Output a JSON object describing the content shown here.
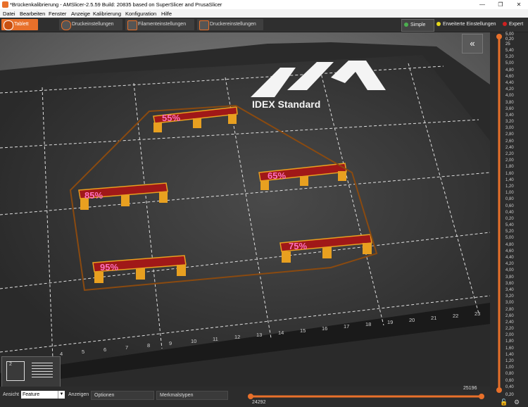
{
  "window": {
    "title": "*Brückenkalibrierung - AMSlicer-2.5.59 Build: 20835  based on SuperSlicer and PrusaSlicer",
    "minimize": "—",
    "restore": "❐",
    "close": "✕"
  },
  "menu": [
    "Datei",
    "Bearbeiten",
    "Fenster",
    "Anzeige",
    "Kalibrierung",
    "Konfiguration",
    "Hilfe"
  ],
  "tabs": [
    {
      "label": "Tablett",
      "active": true
    },
    {
      "label": "Druckeinstellungen"
    },
    {
      "label": "Filamenteinstellungen"
    },
    {
      "label": "Druckereinstellungen"
    }
  ],
  "modes": [
    {
      "label": "Simple",
      "color": "#4caf50"
    },
    {
      "label": "Erweiterte Einstellungen",
      "color": "#e6d81c"
    },
    {
      "label": "Expert",
      "color": "#d02020"
    }
  ],
  "bed": {
    "logo_text": "IDEX Standard",
    "x_ticks": [
      "4",
      "5",
      "6",
      "7",
      "8",
      "9",
      "10",
      "11",
      "12",
      "13",
      "14",
      "15",
      "16",
      "17",
      "18",
      "19",
      "20",
      "21",
      "22",
      "23"
    ]
  },
  "bridges": [
    {
      "label": "55%"
    },
    {
      "label": "65%"
    },
    {
      "label": "85%"
    },
    {
      "label": "75%"
    },
    {
      "label": "95%"
    }
  ],
  "collapse_icon": "«",
  "vslider": {
    "top_values": [
      "5,00",
      "0,20",
      "25"
    ],
    "labels": [
      "5,40",
      "5,20",
      "5,00",
      "4,80",
      "4,60",
      "4,40",
      "4,20",
      "4,00",
      "3,80",
      "3,60",
      "3,40",
      "3,20",
      "3,00",
      "2,80",
      "2,60",
      "2,40",
      "2,20",
      "2,00",
      "1,80",
      "1,60",
      "1,40",
      "1,20",
      "1,00",
      "0,80",
      "0,60",
      "0,40",
      "0,20",
      "5,40",
      "5,20",
      "5,00",
      "4,80",
      "4,60",
      "4,40",
      "4,20",
      "4,00",
      "3,80",
      "3,60",
      "3,40",
      "3,20",
      "3,00",
      "2,80",
      "2,60",
      "2,40",
      "2,20",
      "2,00",
      "1,80",
      "1,60",
      "1,40",
      "1,20",
      "1,00",
      "0,80",
      "0,60",
      "0,40"
    ],
    "bottom_values": [
      "0,20",
      "1"
    ]
  },
  "bottom": {
    "ansicht_label": "Ansicht",
    "view_value": "Feature",
    "anzeigen_label": "Anzeigen",
    "optionen_label": "Optionen",
    "merkmal_label": "Merkmalstypen",
    "slider_max": "25196",
    "slider_min": "24292"
  },
  "view_cube_number": "2",
  "colors": {
    "accent": "#e8702a",
    "bridge": "#b02020",
    "support": "#e8a020",
    "text_pink": "#ff70c0"
  }
}
